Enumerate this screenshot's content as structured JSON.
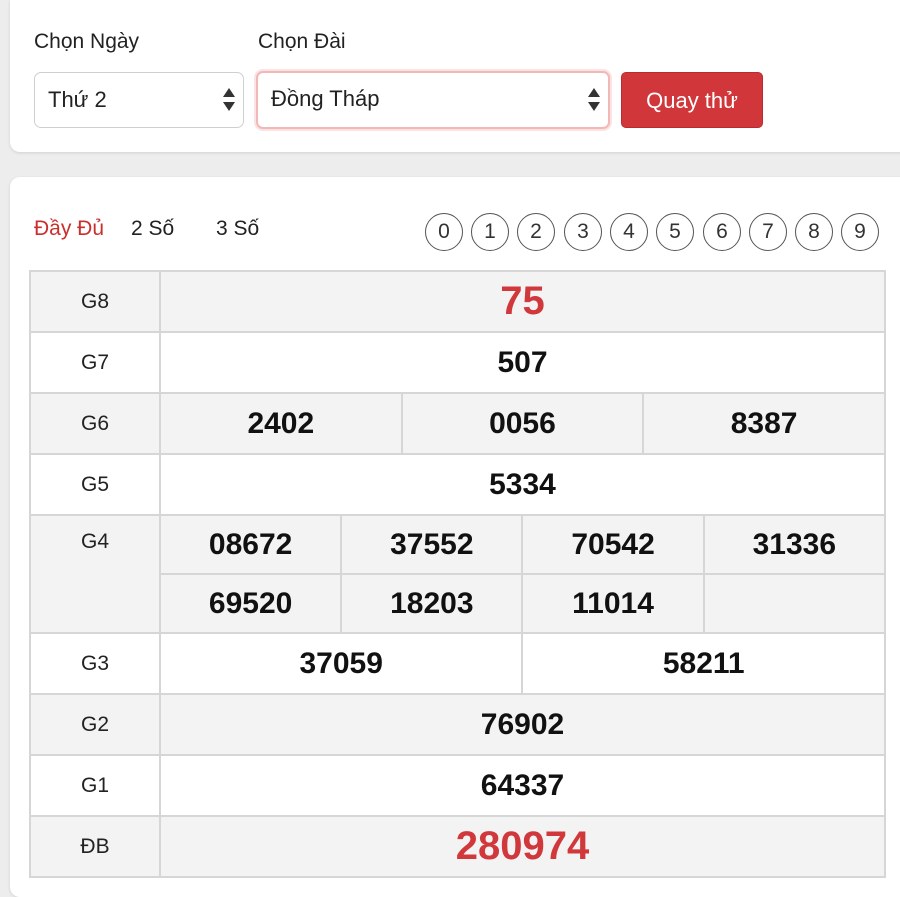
{
  "controls": {
    "day_label": "Chọn Ngày",
    "day_value": "Thứ 2",
    "station_label": "Chọn Đài",
    "station_value": "Đồng Tháp",
    "spin_button": "Quay thử"
  },
  "tabs": [
    "Đầy Đủ",
    "2 Số",
    "3 Số"
  ],
  "digits": [
    "0",
    "1",
    "2",
    "3",
    "4",
    "5",
    "6",
    "7",
    "8",
    "9"
  ],
  "results": {
    "g8": {
      "label": "G8",
      "numbers": [
        "75"
      ]
    },
    "g7": {
      "label": "G7",
      "numbers": [
        "507"
      ]
    },
    "g6": {
      "label": "G6",
      "numbers": [
        "2402",
        "0056",
        "8387"
      ]
    },
    "g5": {
      "label": "G5",
      "numbers": [
        "5334"
      ]
    },
    "g4": {
      "label": "G4",
      "numbers": [
        "08672",
        "37552",
        "70542",
        "31336",
        "69520",
        "18203",
        "11014"
      ]
    },
    "g3": {
      "label": "G3",
      "numbers": [
        "37059",
        "58211"
      ]
    },
    "g2": {
      "label": "G2",
      "numbers": [
        "76902"
      ]
    },
    "g1": {
      "label": "G1",
      "numbers": [
        "64337"
      ]
    },
    "db": {
      "label": "ĐB",
      "numbers": [
        "280974"
      ]
    }
  },
  "colors": {
    "accent": "#d0363a",
    "highlight_number": "#d0383c",
    "active_tab": "#c9302c"
  }
}
